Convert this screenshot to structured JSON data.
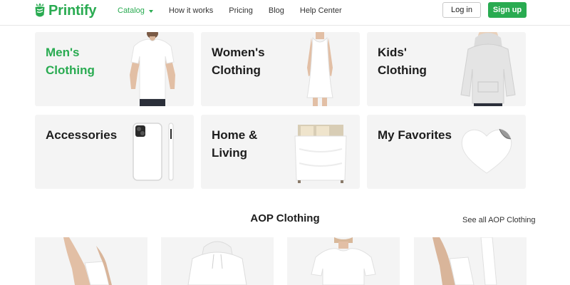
{
  "brand": {
    "name": "Printify",
    "color": "#29ab51"
  },
  "nav": [
    {
      "label": "Catalog",
      "active": true,
      "has_dropdown": true
    },
    {
      "label": "How it works"
    },
    {
      "label": "Pricing"
    },
    {
      "label": "Blog"
    },
    {
      "label": "Help Center"
    }
  ],
  "auth": {
    "login_label": "Log in",
    "signup_label": "Sign up"
  },
  "categories": [
    {
      "title": "Men's Clothing",
      "icon": "mens-tshirt-image",
      "accent": true
    },
    {
      "title": "Women's Clothing",
      "icon": "womens-dress-image"
    },
    {
      "title": "Kids' Clothing",
      "icon": "kids-hoodie-image"
    },
    {
      "title": "Accessories",
      "icon": "phone-case-image"
    },
    {
      "title": "Home & Living",
      "icon": "bedding-image"
    },
    {
      "title": "My Favorites",
      "icon": "heart-sticker-image"
    }
  ],
  "aop_section": {
    "title": "AOP Clothing",
    "see_all_label": "See all AOP Clothing",
    "products": [
      {
        "icon": "socks-image"
      },
      {
        "icon": "hoodie-image"
      },
      {
        "icon": "tshirt-image"
      },
      {
        "icon": "socks-image"
      }
    ]
  },
  "colors": {
    "accent": "#29ab51",
    "card_bg": "#f4f4f4",
    "text": "#1d1d1d"
  }
}
